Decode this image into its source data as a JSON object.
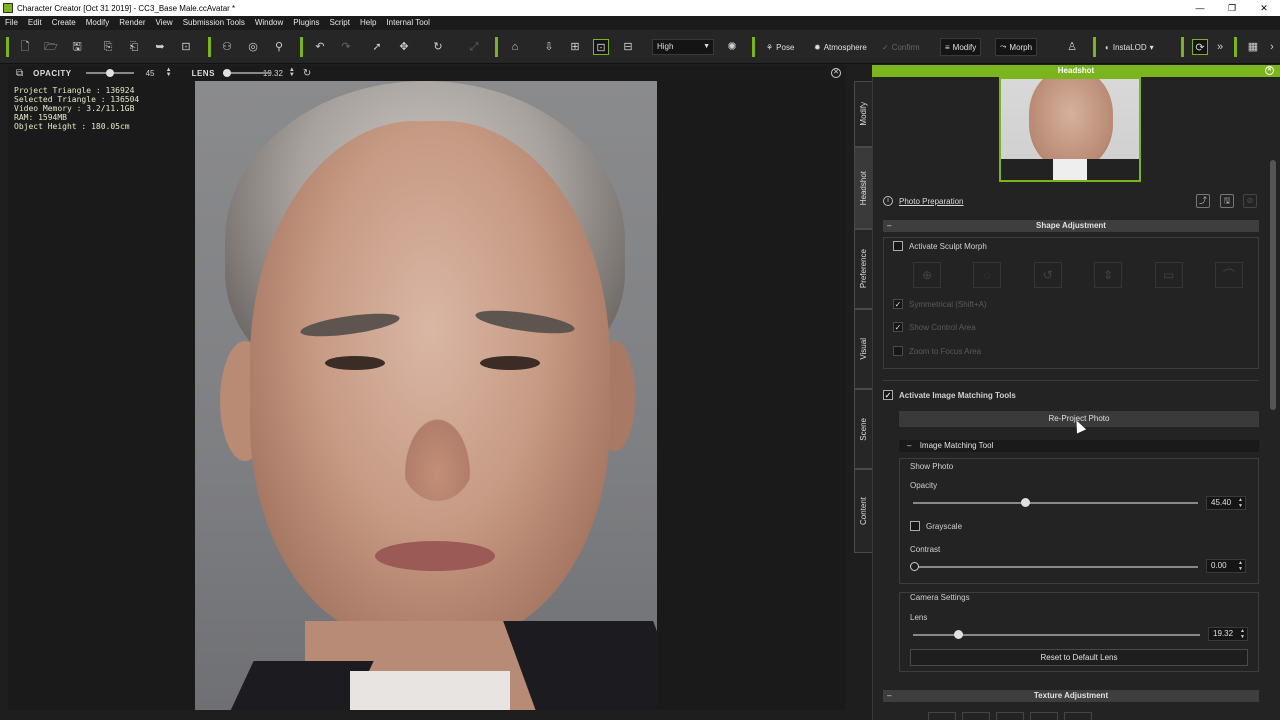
{
  "window": {
    "title": "Character Creator [Oct 31 2019] - CC3_Base Male.ccAvatar *",
    "controls": [
      "—",
      "❐",
      "✕"
    ]
  },
  "menu": [
    "File",
    "Edit",
    "Create",
    "Modify",
    "Render",
    "View",
    "Submission Tools",
    "Window",
    "Plugins",
    "Script",
    "Help",
    "Internal Tool"
  ],
  "toolbar": {
    "quality": "High",
    "pose": "Pose",
    "atmosphere": "Atmosphere",
    "confirm": "Confirm",
    "modify": "Modify",
    "morph": "Morph",
    "instalod": "InstaLOD",
    "more": "»"
  },
  "viewport": {
    "opacity_label": "OPACITY",
    "opacity_value": "45",
    "lens_label": "LENS",
    "lens_value": "19.32",
    "stats": [
      "Project Triangle : 136924",
      "Selected Triangle : 136504",
      "Video Memory : 3.2/11.1GB",
      "RAM: 1594MB",
      "Object Height : 180.05cm"
    ]
  },
  "side_tabs": [
    "Modify",
    "Headshot",
    "Preference",
    "Visual",
    "Scene",
    "Content"
  ],
  "panel": {
    "title": "Headshot",
    "photo_preparation": "Photo Preparation",
    "shape_adjustment": "Shape Adjustment",
    "activate_sculpt_morph": "Activate Sculpt Morph",
    "symmetrical": "Symmetrical (Shift+A)",
    "show_control_area": "Show Control Area",
    "zoom_to_focus_area": "Zoom to Focus Area",
    "activate_image_matching": "Activate Image Matching Tools",
    "reproject_photo": "Re-Project Photo",
    "image_matching_tool": "Image Matching Tool",
    "show_photo": "Show Photo",
    "opacity_label": "Opacity",
    "opacity_value": "45.40",
    "opacity_level": 0.454,
    "grayscale": "Grayscale",
    "contrast_label": "Contrast",
    "contrast_value": "0.00",
    "contrast_level": 0.0,
    "camera_settings": "Camera Settings",
    "lens_label": "Lens",
    "lens_value": "19.32",
    "lens_level": 0.16,
    "reset_lens": "Reset to Default Lens",
    "texture_adjustment": "Texture Adjustment"
  },
  "colors": {
    "accent": "#7ab51d",
    "panel_bg": "#232323",
    "section_bar": "#3e3e3e"
  }
}
